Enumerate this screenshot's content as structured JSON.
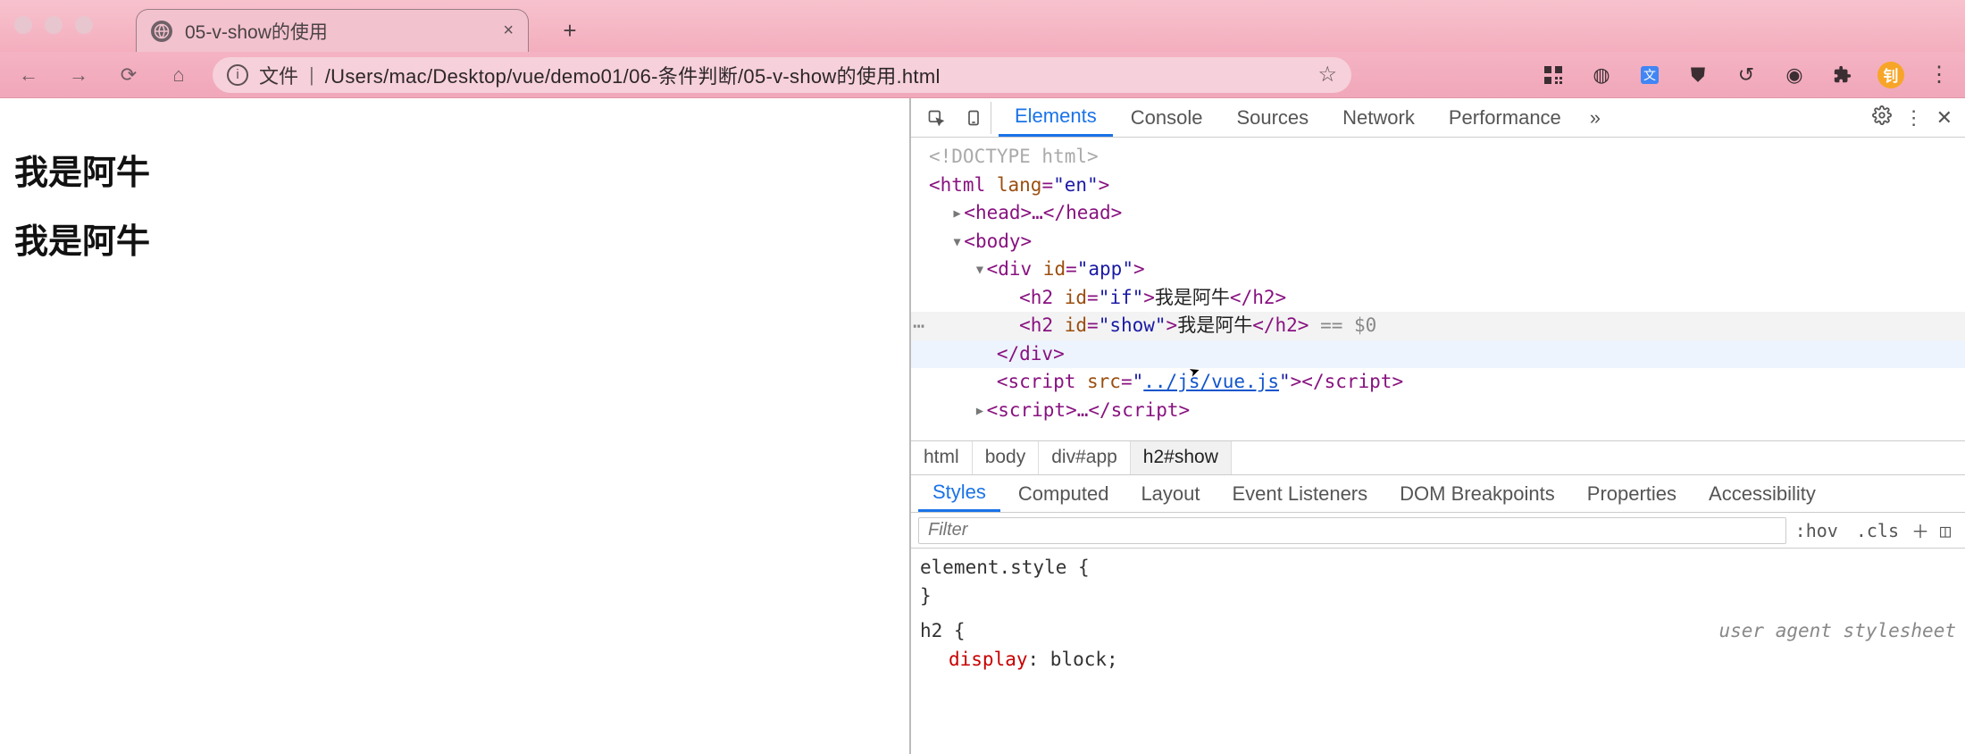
{
  "window": {
    "tab_title": "05-v-show的使用",
    "new_tab_glyph": "+",
    "close_glyph": "×"
  },
  "toolbar": {
    "file_label": "文件",
    "separator": "|",
    "url": "/Users/mac/Desktop/vue/demo01/06-条件判断/05-v-show的使用.html",
    "avatar_initial": "钊"
  },
  "page": {
    "h2_if": "我是阿牛",
    "h2_show": "我是阿牛"
  },
  "devtools": {
    "tabs": [
      "Elements",
      "Console",
      "Sources",
      "Network",
      "Performance"
    ],
    "active_tab": "Elements",
    "more": "»",
    "tree": {
      "doctype": "<!DOCTYPE html>",
      "html_open_pre": "<html ",
      "html_attr": "lang",
      "html_val": "\"en\"",
      "html_open_post": ">",
      "head": "<head>…</head>",
      "body_open": "<body>",
      "div_open_pre": "<div ",
      "div_attr": "id",
      "div_val": "\"app\"",
      "div_open_post": ">",
      "h2_if_pre": "<h2 ",
      "h2_if_attr": "id",
      "h2_if_val": "\"if\"",
      "h2_if_mid": ">",
      "h2_if_txt": "我是阿牛",
      "h2_if_close": "</h2>",
      "h2_show_pre": "<h2 ",
      "h2_show_attr": "id",
      "h2_show_val": "\"show\"",
      "h2_show_mid": ">",
      "h2_show_txt": "我是阿牛",
      "h2_show_close": "</h2>",
      "selected_suffix": " == $0",
      "div_close": "</div>",
      "script1_pre": "<script ",
      "script1_attr": "src",
      "script1_val_open": "\"",
      "script1_link": "../js/vue.js",
      "script1_val_close": "\"",
      "script1_mid": ">",
      "script1_close": "</script>",
      "script2": "<script>…</script>"
    },
    "crumbs": [
      "html",
      "body",
      "div#app",
      "h2#show"
    ],
    "subtabs": [
      "Styles",
      "Computed",
      "Layout",
      "Event Listeners",
      "DOM Breakpoints",
      "Properties",
      "Accessibility"
    ],
    "active_subtab": "Styles",
    "filter_placeholder": "Filter",
    "hov": ":hov",
    "cls": ".cls",
    "styles": {
      "rule1_sel": "element.style {",
      "rule1_close": "}",
      "rule2_sel": "h2 {",
      "rule2_note": "user agent stylesheet",
      "rule2_prop": "display",
      "rule2_val": ": block;"
    }
  }
}
